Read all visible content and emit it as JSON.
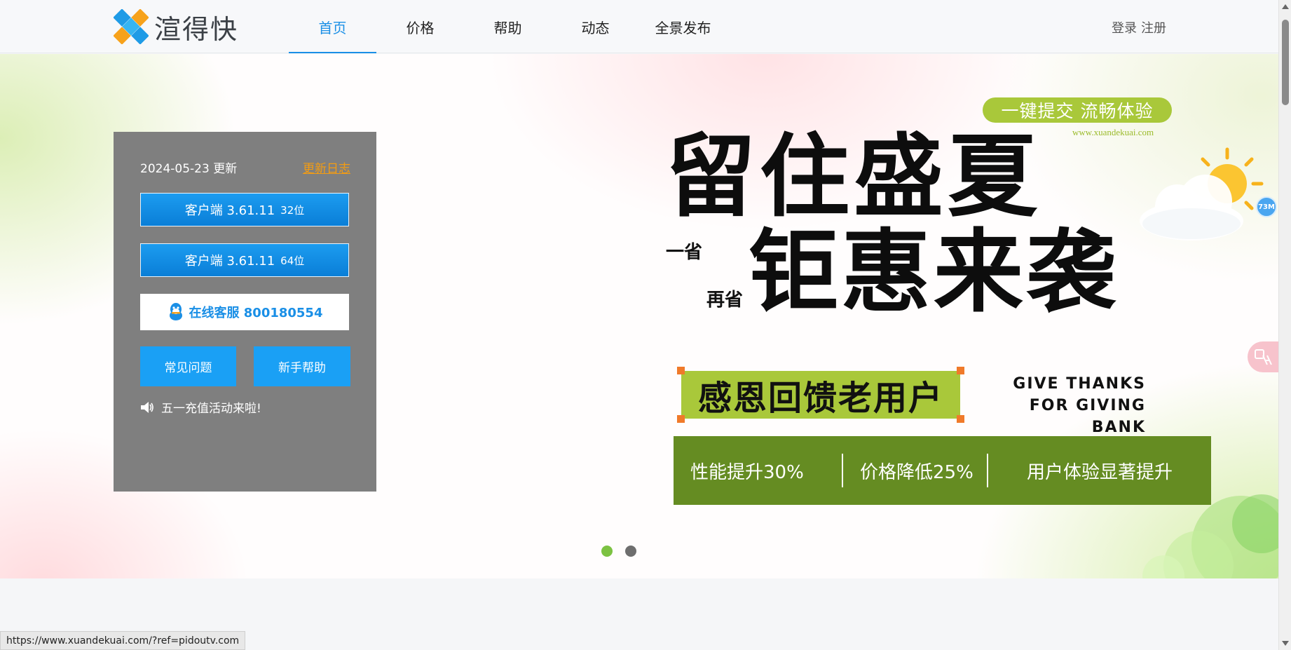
{
  "header": {
    "logo_text": "渲得快",
    "nav": [
      {
        "label": "首页",
        "active": true
      },
      {
        "label": "价格",
        "active": false
      },
      {
        "label": "帮助",
        "active": false
      },
      {
        "label": "动态",
        "active": false
      },
      {
        "label": "全景发布",
        "active": false
      }
    ],
    "login_label": "登录",
    "register_label": "注册"
  },
  "panel": {
    "update_date": "2024-05-23 更新",
    "changelog_label": "更新日志",
    "download_32": {
      "version": "客户端 3.61.11",
      "bits": "32位"
    },
    "download_64": {
      "version": "客户端 3.61.11",
      "bits": "64位"
    },
    "service_label": "在线客服 800180554",
    "faq_label": "常见问题",
    "newbie_label": "新手帮助",
    "notice_text": "五一充值活动来啦!"
  },
  "promo": {
    "slogan": "一键提交 流畅体验",
    "site_url": "www.xuandekuai.com",
    "headline_1": "留住盛夏",
    "sub_1": "一省",
    "sub_2": "再省",
    "headline_2": "钜惠来袭",
    "thanks_cn": "感恩回馈老用户",
    "thanks_en_1": "GIVE THANKS",
    "thanks_en_2": "FOR GIVING BANK",
    "stats": [
      "性能提升30%",
      "价格降低25%",
      "用户体验显著提升"
    ]
  },
  "carousel": {
    "dot_colors": [
      "#7cc242",
      "#6e6e6e"
    ]
  },
  "widgets": {
    "memory_badge": "73M"
  },
  "status_url": "https://www.xuandekuai.com/?ref=pidoutv.com",
  "colors": {
    "accent": "#1a8fe6",
    "promo_green": "#a9c83a",
    "stats_green": "#658c22",
    "changelog_orange": "#f39c12"
  }
}
